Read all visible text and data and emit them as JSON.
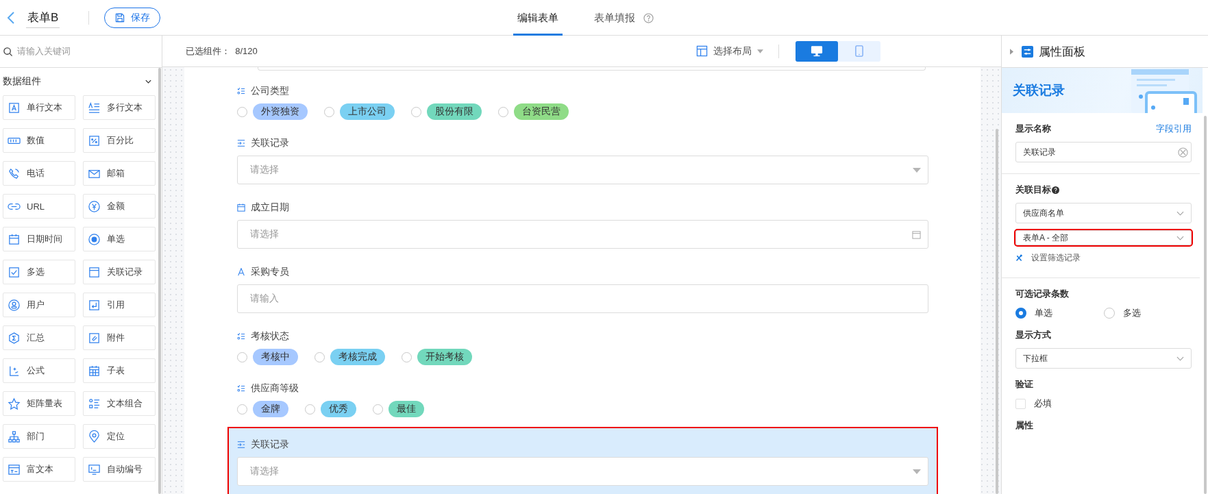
{
  "header": {
    "title": "表单B",
    "save_button": "保存",
    "tabs": [
      {
        "label": "编辑表单",
        "selected": true,
        "help": false
      },
      {
        "label": "表单填报",
        "selected": false,
        "help": true
      }
    ]
  },
  "sidebar": {
    "search": {
      "placeholder": "请输入关键词"
    },
    "group": {
      "title": "数据组件",
      "expanded": true
    },
    "items": [
      {
        "label": "单行文本"
      },
      {
        "label": "多行文本"
      },
      {
        "label": "数值"
      },
      {
        "label": "百分比"
      },
      {
        "label": "电话"
      },
      {
        "label": "邮箱"
      },
      {
        "label": "URL"
      },
      {
        "label": "金额"
      },
      {
        "label": "日期时间"
      },
      {
        "label": "单选"
      },
      {
        "label": "多选"
      },
      {
        "label": "关联记录"
      },
      {
        "label": "用户"
      },
      {
        "label": "引用"
      },
      {
        "label": "汇总"
      },
      {
        "label": "附件"
      },
      {
        "label": "公式"
      },
      {
        "label": "子表"
      },
      {
        "label": "矩阵量表"
      },
      {
        "label": "文本组合"
      },
      {
        "label": "部门"
      },
      {
        "label": "定位"
      },
      {
        "label": "富文本"
      },
      {
        "label": "自动编号"
      }
    ]
  },
  "toolbar": {
    "selected_count": "已选组件：  8/120",
    "layout_button": "选择布局",
    "views": [
      {
        "kind": "desktop",
        "selected": true
      },
      {
        "kind": "mobile",
        "selected": false
      }
    ]
  },
  "form": {
    "fields": [
      {
        "kind": "radio",
        "label": "公司类型",
        "highlighted": false,
        "options": [
          {
            "label": "外资独资",
            "color": "#a6c8ff",
            "selected": false
          },
          {
            "label": "上市公司",
            "color": "#7ad0f2",
            "selected": false
          },
          {
            "label": "股份有限",
            "color": "#72d8bc",
            "selected": false
          },
          {
            "label": "台资民营",
            "color": "#8fdc87",
            "selected": false
          }
        ]
      },
      {
        "kind": "select",
        "label": "关联记录",
        "placeholder": "请选择",
        "highlighted": false
      },
      {
        "kind": "date",
        "label": "成立日期",
        "placeholder": "请选择",
        "highlighted": false
      },
      {
        "kind": "input",
        "label": "采购专员",
        "placeholder": "请输入",
        "highlighted": false
      },
      {
        "kind": "radio",
        "label": "考核状态",
        "highlighted": false,
        "options": [
          {
            "label": "考核中",
            "color": "#a6c8ff",
            "selected": false
          },
          {
            "label": "考核完成",
            "color": "#7ad0f2",
            "selected": false
          },
          {
            "label": "开始考核",
            "color": "#72d8bc",
            "selected": false
          }
        ]
      },
      {
        "kind": "radio",
        "label": "供应商等级",
        "highlighted": false,
        "options": [
          {
            "label": "金牌",
            "color": "#a6c8ff",
            "selected": false
          },
          {
            "label": "优秀",
            "color": "#7ad0f2",
            "selected": false
          },
          {
            "label": "最佳",
            "color": "#72d8bc",
            "selected": false
          }
        ]
      },
      {
        "kind": "select",
        "label": "关联记录",
        "placeholder": "请选择",
        "highlighted": true
      }
    ]
  },
  "panel": {
    "title": "属性面板",
    "banner": "关联记录",
    "display_name": {
      "label": "显示名称",
      "link": "字段引用",
      "value": "关联记录"
    },
    "target": {
      "label": "关联目标",
      "form": "供应商名单",
      "view": "表单A - 全部",
      "view_highlighted": true,
      "filter_link": "设置筛选记录"
    },
    "count": {
      "label": "可选记录条数",
      "options": [
        {
          "label": "单选",
          "selected": true
        },
        {
          "label": "多选",
          "selected": false
        }
      ]
    },
    "display_mode": {
      "label": "显示方式",
      "value": "下拉框"
    },
    "validation": {
      "label": "验证",
      "required": {
        "label": "必填",
        "checked": false
      }
    },
    "properties": {
      "label": "属性"
    }
  }
}
